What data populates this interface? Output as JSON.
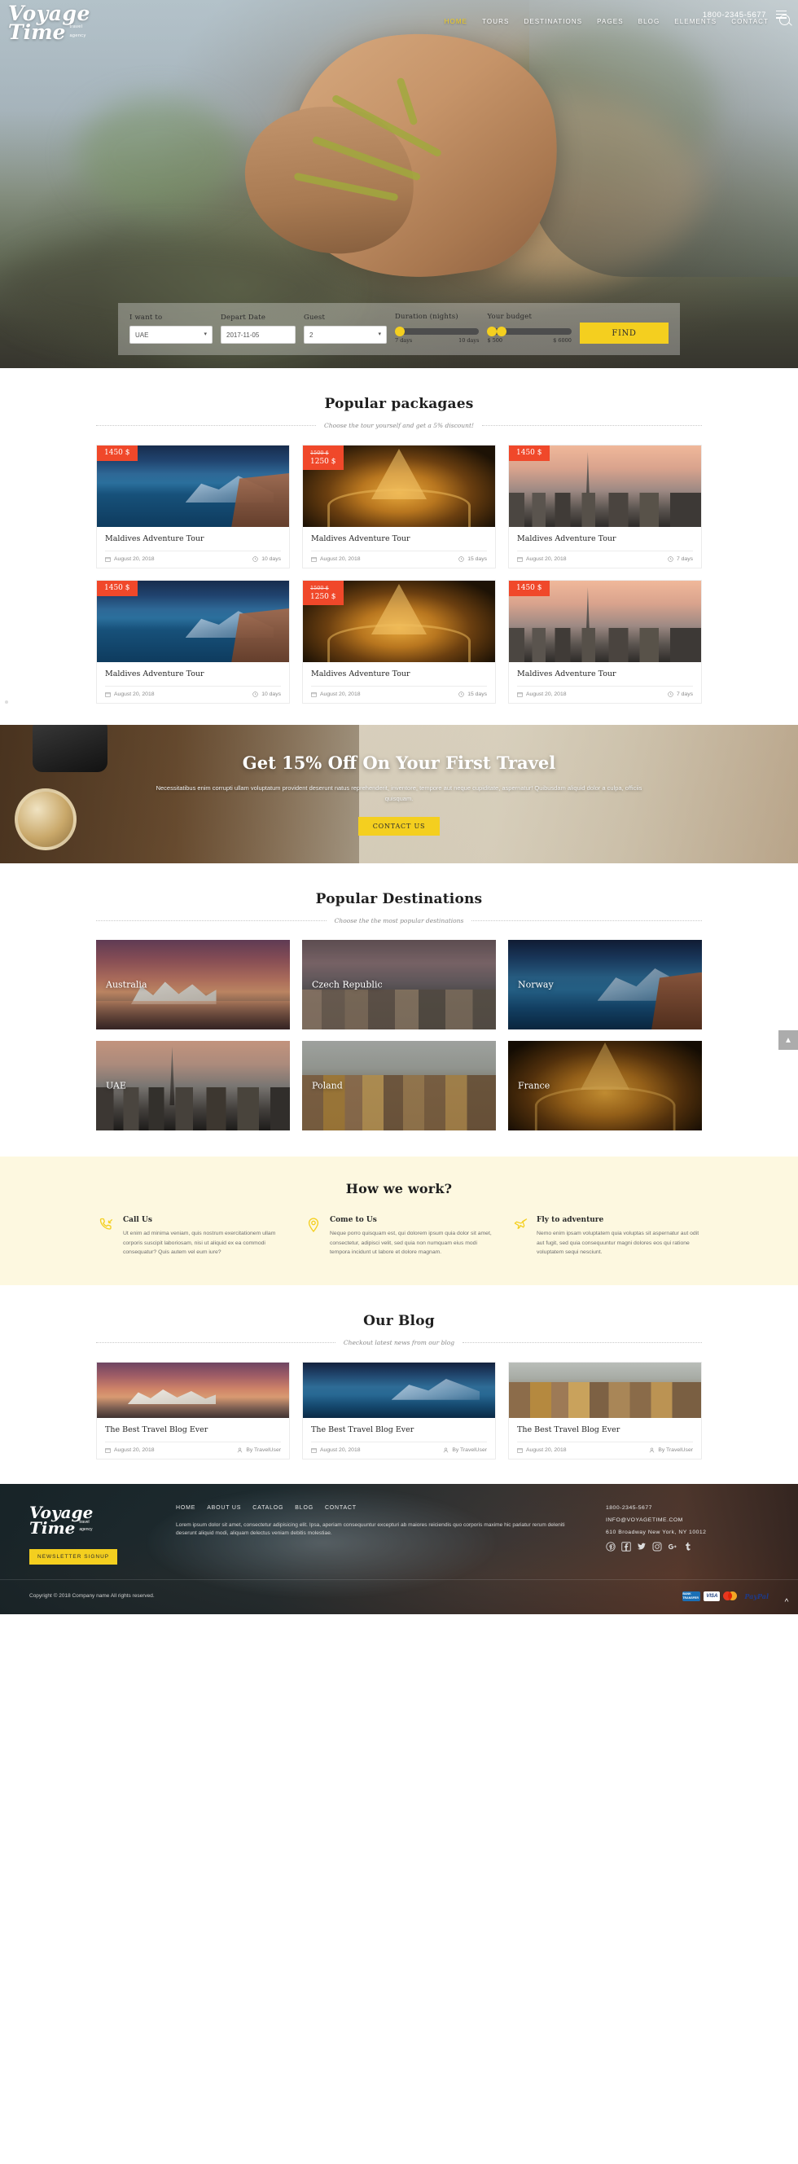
{
  "header": {
    "brand_line1": "Voyage",
    "brand_line2": "Time",
    "brand_sub1": "travel",
    "brand_sub2": "agency",
    "phone": "1800-2345-5677",
    "nav": [
      {
        "label": "HOME",
        "active": true
      },
      {
        "label": "TOURS",
        "active": false
      },
      {
        "label": "DESTINATIONS",
        "active": false
      },
      {
        "label": "PAGES",
        "active": false
      },
      {
        "label": "BLOG",
        "active": false
      },
      {
        "label": "ELEMENTS",
        "active": false
      },
      {
        "label": "CONTACT",
        "active": false
      }
    ],
    "search_icon": "search-icon",
    "menu_icon": "hamburger-icon"
  },
  "booking": {
    "want_to_label": "I want to",
    "want_to_value": "UAE",
    "depart_label": "Depart Date",
    "depart_value": "2017-11-05",
    "guest_label": "Guest",
    "guest_value": "2",
    "duration_label": "Duration (nights)",
    "duration_min": "7 days",
    "duration_max": "10 days",
    "budget_label": "Your budget",
    "budget_min": "$ 500",
    "budget_max": "$ 6000",
    "find_label": "FIND"
  },
  "packages": {
    "title": "Popular packagaes",
    "subtitle": "Choose the tour yourself and get a 5% discount!",
    "items": [
      {
        "price": "1450 $",
        "old_price": "",
        "title": "Maldives Adventure Tour",
        "date": "August 20, 2018",
        "duration": "10 days",
        "art": "img-maldives"
      },
      {
        "price": "1250 $",
        "old_price": "1500 $",
        "title": "Maldives Adventure Tour",
        "date": "August 20, 2018",
        "duration": "15 days",
        "art": "img-eiffel"
      },
      {
        "price": "1450 $",
        "old_price": "",
        "title": "Maldives Adventure Tour",
        "date": "August 20, 2018",
        "duration": "7 days",
        "art": "img-uae"
      },
      {
        "price": "1450 $",
        "old_price": "",
        "title": "Maldives Adventure Tour",
        "date": "August 20, 2018",
        "duration": "10 days",
        "art": "img-maldives"
      },
      {
        "price": "1250 $",
        "old_price": "1500 $",
        "title": "Maldives Adventure Tour",
        "date": "August 20, 2018",
        "duration": "15 days",
        "art": "img-eiffel"
      },
      {
        "price": "1450 $",
        "old_price": "",
        "title": "Maldives Adventure Tour",
        "date": "August 20, 2018",
        "duration": "7 days",
        "art": "img-uae"
      }
    ]
  },
  "promo": {
    "title": "Get 15% Off On Your First Travel",
    "text": "Necessitatibus enim corrupti ullam voluptatum provident deserunt natus reprehenderit, inventore, tempore aut neque cupiditate, aspernatur! Quibusdam aliquid dolor a culpa, officiis quisquam.",
    "button": "CONTACT US"
  },
  "destinations": {
    "title": "Popular Destinations",
    "subtitle": "Choose the the most popular destinations",
    "items": [
      {
        "label": "Australia",
        "art": "d-aus"
      },
      {
        "label": "Czech Republic",
        "art": "d-czech"
      },
      {
        "label": "Norway",
        "art": "d-norway"
      },
      {
        "label": "UAE",
        "art": "d-uae"
      },
      {
        "label": "Poland",
        "art": "d-poland"
      },
      {
        "label": "France",
        "art": "d-france"
      }
    ]
  },
  "how_we_work": {
    "title": "How we work?",
    "items": [
      {
        "icon": "phone-icon",
        "title": "Call Us",
        "text": "Ut enim ad minima veniam, quis nostrum exercitationem ullam corporis suscipit laboriosam, nisi ut aliquid ex ea commodi consequatur? Quis autem vel eum iure?"
      },
      {
        "icon": "map-pin-icon",
        "title": "Come to Us",
        "text": "Neque porro quisquam est, qui dolorem ipsum quia dolor sit amet, consectetur, adipisci velit, sed quia non numquam eius modi tempora incidunt ut labore et dolore magnam."
      },
      {
        "icon": "airplane-icon",
        "title": "Fly to adventure",
        "text": "Nemo enim ipsam voluptatem quia voluptas sit aspernatur aut odit aut fugit, sed quia consequuntur magni dolores eos qui ratione voluptatem sequi nesciunt."
      }
    ]
  },
  "blog": {
    "title": "Our Blog",
    "subtitle": "Checkout latest news from our blog",
    "items": [
      {
        "title": "The Best Travel Blog Ever",
        "date": "August 20, 2018",
        "author": "By TravelUser",
        "art": "b-aus"
      },
      {
        "title": "The Best Travel Blog Ever",
        "date": "August 20, 2018",
        "author": "By TravelUser",
        "art": "b-nor"
      },
      {
        "title": "The Best Travel Blog Ever",
        "date": "August 20, 2018",
        "author": "By TravelUser",
        "art": "b-pol"
      }
    ]
  },
  "footer": {
    "brand_line1": "Voyage",
    "brand_line2": "Time",
    "brand_sub1": "travel",
    "brand_sub2": "agency",
    "newsletter_button": "NEWSLETTER SIGNUP",
    "nav": [
      "HOME",
      "ABOUT US",
      "CATALOG",
      "BLOG",
      "CONTACT"
    ],
    "about_text": "Lorem ipsum dolor sit amet, consectetur adipisicing elit. Ipsa, aperiam consequuntur excepturi ab maiores reiciendis quo corporis maxime hic pariatur rerum deleniti deserunt aliquid modi, aliquam delectus veniam debitis molestiae.",
    "phone": "1800-2345-5677",
    "email": "INFO@VOYAGETIME.COM",
    "address": "610 Broadway New York, NY 10012",
    "socials": [
      {
        "name": "pinterest-icon",
        "glyph": "Ⓟ"
      },
      {
        "name": "facebook-icon",
        "glyph": "f"
      },
      {
        "name": "twitter-icon",
        "glyph": "ᴠ"
      },
      {
        "name": "instagram-icon",
        "glyph": "▣"
      },
      {
        "name": "google-plus-icon",
        "glyph": "G+"
      },
      {
        "name": "tumblr-icon",
        "glyph": "t"
      }
    ],
    "copyright": "Copyright © 2018 Company name All rights reserved.",
    "payments": [
      {
        "name": "bank-transfer-icon",
        "label": "BANK TRANSFER"
      },
      {
        "name": "visa-icon",
        "label": "VISA"
      },
      {
        "name": "mastercard-icon",
        "label": ""
      },
      {
        "name": "paypal-icon",
        "label": "PayPal"
      }
    ]
  },
  "colors": {
    "accent_yellow": "#f4cf1f",
    "badge_red": "#f0482a",
    "cream": "#fdf8e0"
  }
}
